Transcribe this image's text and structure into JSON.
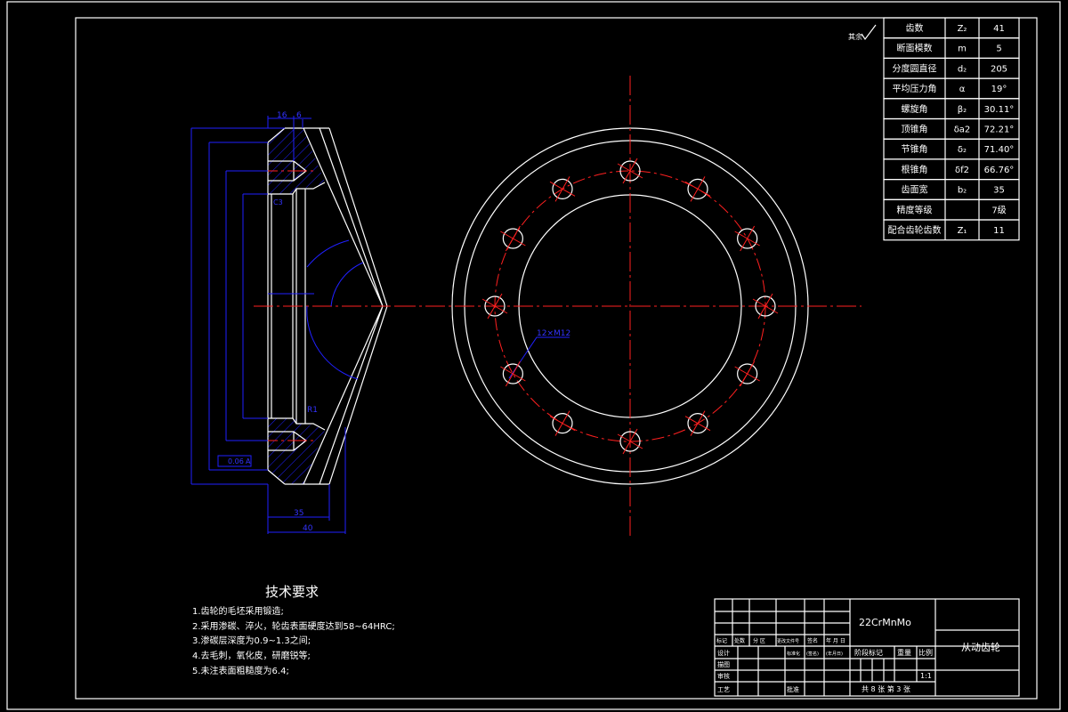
{
  "roughness_note": "其余",
  "params": [
    {
      "name": "齿数",
      "symbol": "Z₂",
      "value": "41"
    },
    {
      "name": "断面模数",
      "symbol": "m",
      "value": "5"
    },
    {
      "name": "分度圆直径",
      "symbol": "d₂",
      "value": "205"
    },
    {
      "name": "平均压力角",
      "symbol": "α",
      "value": "19°"
    },
    {
      "name": "螺旋角",
      "symbol": "β₂",
      "value": "30.11°"
    },
    {
      "name": "顶锥角",
      "symbol": "δa2",
      "value": "72.21°"
    },
    {
      "name": "节锥角",
      "symbol": "δ₂",
      "value": "71.40°"
    },
    {
      "name": "根锥角",
      "symbol": "δf2",
      "value": "66.76°"
    },
    {
      "name": "齿面宽",
      "symbol": "b₂",
      "value": "35"
    },
    {
      "name": "精度等级",
      "symbol": "",
      "value": "7级"
    },
    {
      "name": "配合齿轮齿数",
      "symbol": "Z₁",
      "value": "11"
    }
  ],
  "dims": {
    "d16": "16",
    "d6": "6",
    "c3": "C3",
    "r1": "R1",
    "runout": "0.06",
    "datum": "A",
    "w35": "35",
    "w40": "40",
    "holes": "12×M12"
  },
  "tech": {
    "title": "技术要求",
    "items": [
      "1.齿轮的毛坯采用锻造;",
      "2.采用渗碳、淬火，轮齿表面硬度达到58~64HRC;",
      "3.渗碳层深度为0.9~1.3之间;",
      "4.去毛刺，氧化皮，研磨锐等;",
      "5.未注表面粗糙度为6.4;"
    ]
  },
  "title_block": {
    "material": "22CrMnMo",
    "part_name": "从动齿轮",
    "hdr": [
      "标记",
      "处数",
      "分 区",
      "更改文件号",
      "签名",
      "年 月 日"
    ],
    "rows": [
      "设计",
      "描图",
      "审核",
      "工艺"
    ],
    "std": "标准化",
    "sign": "(签名)",
    "date": "(年月日)",
    "approve": "批准",
    "stage": "阶段标记",
    "mass": "重量",
    "scale_label": "比例",
    "scale": "1:1",
    "sheets": "共 8 张  第 3 张"
  }
}
